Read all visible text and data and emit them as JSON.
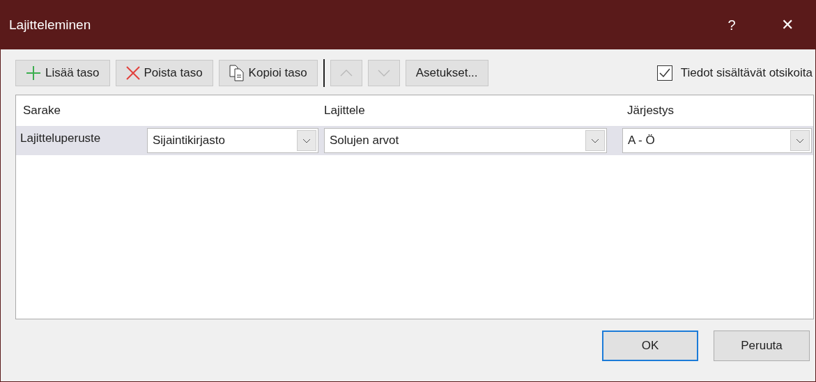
{
  "window": {
    "title": "Lajitteleminen",
    "help": "?",
    "close": "✕"
  },
  "toolbar": [
    {
      "kind": "add",
      "label": "Lisää taso",
      "disabled": false
    },
    {
      "kind": "delete",
      "label": "Poista taso",
      "disabled": false
    },
    {
      "kind": "copy",
      "label": "Kopioi taso",
      "disabled": false
    },
    {
      "kind": "up",
      "disabled": true
    },
    {
      "kind": "down",
      "disabled": true
    },
    {
      "kind": "text",
      "label": "Asetukset...",
      "disabled": false
    }
  ],
  "headers_checkbox": {
    "label": "Tiedot sisältävät otsikoita",
    "checked": true
  },
  "table": {
    "columns": [
      "Sarake",
      "Lajittele",
      "Järjestys"
    ],
    "rows": [
      {
        "label": "Lajitteluperuste",
        "selected": true,
        "column": "Sijaintikirjasto",
        "sort_on": "Solujen arvot",
        "order": "A - Ö"
      }
    ]
  },
  "buttons": [
    {
      "label": "OK",
      "default": true
    },
    {
      "label": "Peruuta",
      "default": false
    }
  ]
}
